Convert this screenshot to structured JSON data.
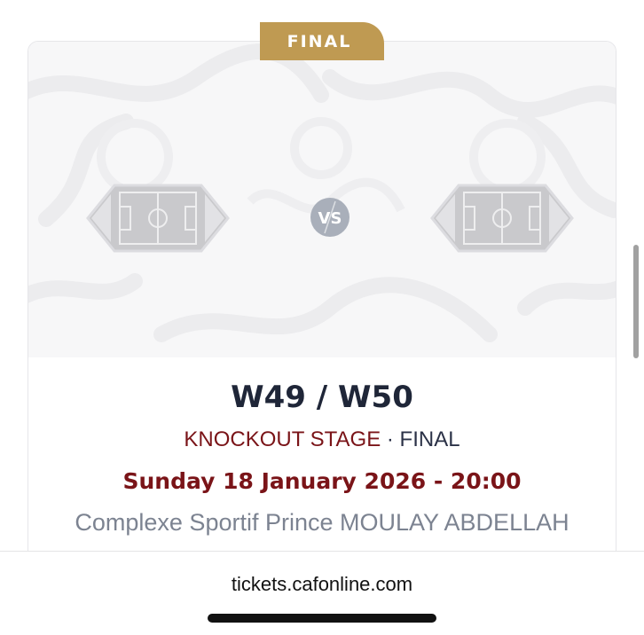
{
  "match": {
    "stage_badge": "FINAL",
    "vs_label": "VS",
    "title": "W49 / W50",
    "stage_primary": "KNOCKOUT STAGE",
    "stage_secondary": "· FINAL",
    "datetime": "Sunday 18 January 2026 - 20:00",
    "venue": "Complexe Sportif Prince MOULAY ABDELLAH",
    "home_team_icon": "team-placeholder-pitch-icon",
    "away_team_icon": "team-placeholder-pitch-icon"
  },
  "browser": {
    "url": "tickets.cafonline.com"
  },
  "colors": {
    "gold_badge": "#bf9a52",
    "title_dark": "#1f2638",
    "accent_red": "#7a1418",
    "venue_gray": "#7c8391",
    "vs_circle": "#a9afba"
  }
}
